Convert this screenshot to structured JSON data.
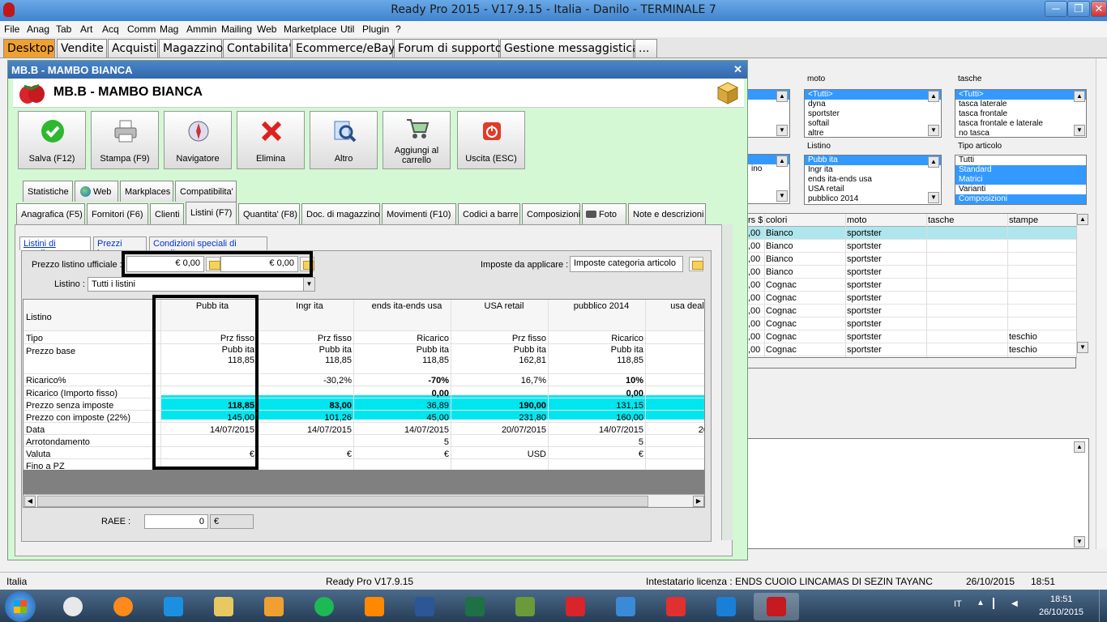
{
  "window": {
    "title": "Ready Pro 2015 - V17.9.15 - Italia - Danilo - TERMINALE 7",
    "min": "─",
    "max": "❐",
    "close": "✕"
  },
  "menu": [
    "File",
    "Anag",
    "Tab",
    "Art",
    "Acq",
    "Comm",
    "Mag",
    "Ammin",
    "Mailing",
    "Web",
    "Marketplace",
    "Util",
    "Plugin",
    "?"
  ],
  "tabs": [
    "Desktop",
    "Vendite",
    "Acquisti",
    "Magazzino",
    "Contabilita'",
    "Ecommerce/eBay",
    "Forum di supporto",
    "Gestione messaggistica",
    "..."
  ],
  "bg": {
    "moto": {
      "caption": "moto",
      "items": [
        "<Tutti>",
        "dyna",
        "sportster",
        "softail",
        "altre"
      ]
    },
    "tasche": {
      "caption": "tasche",
      "items": [
        "<Tutti>",
        "tasca laterale",
        "tasca frontale",
        "tasca frontale e laterale",
        "no tasca"
      ]
    },
    "listino": {
      "caption": "Listino",
      "items": [
        "Pubb ita",
        "Ingr ita",
        "ends ita-ends usa",
        "USA retail",
        "pubblico 2014"
      ]
    },
    "tipo": {
      "caption": "Tipo articolo",
      "items": [
        "Tutti",
        "Standard",
        "Matrici",
        "Varianti",
        "Composizioni"
      ]
    },
    "partial": "ino",
    "grid": {
      "headers": [
        "rs $",
        "colori",
        "moto",
        "tasche",
        "stampe"
      ],
      "rows": [
        [
          ",00",
          "Bianco",
          "sportster",
          "",
          ""
        ],
        [
          ",00",
          "Bianco",
          "sportster",
          "",
          ""
        ],
        [
          ",00",
          "Bianco",
          "sportster",
          "",
          ""
        ],
        [
          ",00",
          "Bianco",
          "sportster",
          "",
          ""
        ],
        [
          ",00",
          "Cognac",
          "sportster",
          "",
          ""
        ],
        [
          ",00",
          "Cognac",
          "sportster",
          "",
          ""
        ],
        [
          ",00",
          "Cognac",
          "sportster",
          "",
          ""
        ],
        [
          ",00",
          "Cognac",
          "sportster",
          "",
          ""
        ],
        [
          ",00",
          "Cognac",
          "sportster",
          "",
          "teschio"
        ],
        [
          ",00",
          "Cognac",
          "sportster",
          "",
          "teschio"
        ]
      ]
    }
  },
  "dialog": {
    "title": "MB.B - MAMBO BIANCA",
    "close": "✕",
    "heading": "MB.B - MAMBO BIANCA",
    "buttons": [
      "Salva (F12)",
      "Stampa (F9)",
      "Navigatore",
      "Elimina",
      "Altro",
      "Aggiungi al carrello",
      "Uscita (ESC)"
    ],
    "tabs_row1": [
      "Statistiche",
      "Web",
      "Markplaces",
      "Compatibilita'"
    ],
    "tabs_row2": [
      "Anagrafica (F5)",
      "Fornitori (F6)",
      "Clienti",
      "Listini (F7)",
      "Quantita' (F8)",
      "Doc. di magazzino",
      "Movimenti (F10)",
      "Codici a barre",
      "Composizioni",
      "Foto",
      "Note e descrizioni"
    ],
    "subtabs": [
      "Listini di vendita",
      "Prezzi base",
      "Condizioni speciali di vendita"
    ],
    "prezzo_label": "Prezzo listino ufficiale :",
    "prezzo1": "€ 0,00",
    "prezzo2": "€ 0,00",
    "imposte_label": "Imposte da applicare :",
    "imposte_value": "Imposte categoria articolo",
    "listino_label": "Listino :",
    "listino_value": "Tutti i listini",
    "raee_label": "RAEE :",
    "raee_value": "0",
    "raee_currency": "€"
  },
  "pricegrid": {
    "rowlabels": [
      "Listino",
      "Tipo",
      "Prezzo base",
      "Ricarico%",
      "Ricarico (Importo fisso)",
      "Prezzo senza imposte",
      "Prezzo con imposte (22%)",
      "Data",
      "Arrotondamento",
      "Valuta",
      "Fino a PZ"
    ],
    "columns": [
      {
        "name": "Pubb ita",
        "tipo": "Prz fisso",
        "base1": "Pubb ita",
        "base2": "118,85",
        "ric": "",
        "ricfix": "",
        "senza": "118,85",
        "con": "145,00",
        "data": "14/07/2015",
        "arr": "",
        "val": "€"
      },
      {
        "name": "Ingr ita",
        "tipo": "Prz fisso",
        "base1": "Pubb ita",
        "base2": "118,85",
        "ric": "-30,2%",
        "ricfix": "",
        "senza": "83,00",
        "con": "101,26",
        "data": "14/07/2015",
        "arr": "",
        "val": "€"
      },
      {
        "name": "ends ita-ends usa",
        "tipo": "Ricarico",
        "base1": "Pubb ita",
        "base2": "118,85",
        "ric": "-70%",
        "ricfix": "0,00",
        "senza": "36,89",
        "con": "45,00",
        "data": "14/07/2015",
        "arr": "5",
        "val": "€"
      },
      {
        "name": "USA retail",
        "tipo": "Prz fisso",
        "base1": "Pubb ita",
        "base2": "162,81",
        "ric": "16,7%",
        "ricfix": "",
        "senza": "190,00",
        "con": "231,80",
        "data": "20/07/2015",
        "arr": "",
        "val": "USD"
      },
      {
        "name": "pubblico 2014",
        "tipo": "Ricarico",
        "base1": "Pubb ita",
        "base2": "118,85",
        "ric": "10%",
        "ricfix": "0,00",
        "senza": "131,15",
        "con": "160,00",
        "data": "14/07/2015",
        "arr": "5",
        "val": "€"
      },
      {
        "name": "usa deal",
        "tipo": "",
        "base1": "",
        "base2": "",
        "ric": "",
        "ricfix": "",
        "senza": "",
        "con": "",
        "data": "20",
        "arr": "",
        "val": ""
      }
    ]
  },
  "statusbar": {
    "country": "Italia",
    "version": "Ready Pro V17.9.15",
    "licenza": "Intestatario licenza : ENDS CUOIO LINCAMAS DI SEZIN TAYANC",
    "date": "26/10/2015",
    "time": "18:51"
  },
  "taskbar": {
    "lang": "IT",
    "clock_time": "18:51",
    "clock_date": "26/10/2015",
    "apps": [
      "chrome-icon",
      "firefox-icon",
      "ie-icon",
      "explorer-icon",
      "media-player-icon",
      "spotify-icon",
      "vlc-icon",
      "word-icon",
      "excel-icon",
      "project-icon",
      "readypro-icon",
      "paint-icon",
      "acrobat-icon",
      "teamviewer-icon",
      "readypro-active-icon"
    ]
  },
  "colors": {
    "highlight": "#00e6f0",
    "accent": "#f0a030",
    "dialog_bg": "#d4f7d4"
  }
}
